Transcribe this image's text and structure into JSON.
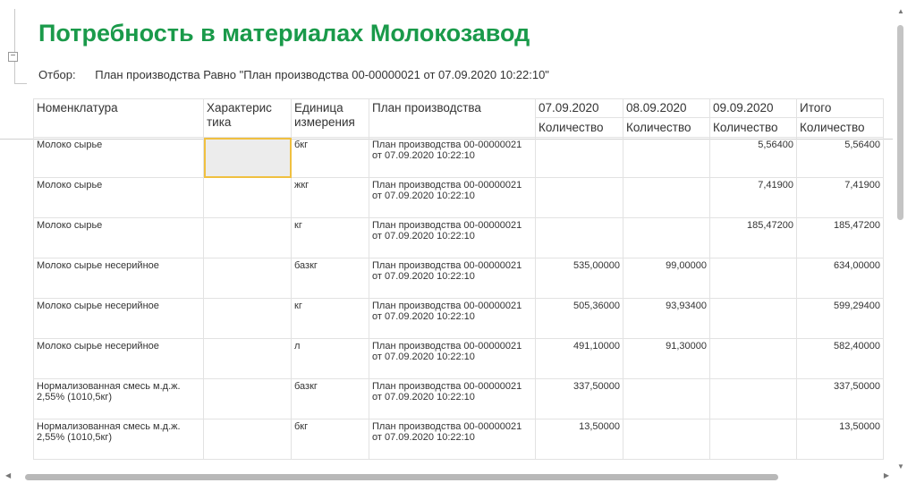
{
  "report": {
    "title": "Потребность в материалах Молокозавод",
    "filter_label": "Отбор:",
    "filter_value": "План производства Равно \"План производства 00-00000021 от 07.09.2020 10:22:10\""
  },
  "columns": {
    "nomenclature": "Номенклатура",
    "characteristic": "Характеристика",
    "unit": "Единица измерения",
    "plan": "План производства",
    "dates": [
      "07.09.2020",
      "08.09.2020",
      "09.09.2020"
    ],
    "total": "Итого",
    "quantity": "Количество"
  },
  "rows": [
    {
      "name": "Молоко сырье",
      "char": "",
      "unit": "бкг",
      "plan": "План производства 00-00000021 от 07.09.2020 10:22:10",
      "d1": "",
      "d2": "",
      "d3": "5,56400",
      "total": "5,56400"
    },
    {
      "name": "Молоко сырье",
      "char": "",
      "unit": "жкг",
      "plan": "План производства 00-00000021 от 07.09.2020 10:22:10",
      "d1": "",
      "d2": "",
      "d3": "7,41900",
      "total": "7,41900"
    },
    {
      "name": "Молоко сырье",
      "char": "",
      "unit": "кг",
      "plan": "План производства 00-00000021 от 07.09.2020 10:22:10",
      "d1": "",
      "d2": "",
      "d3": "185,47200",
      "total": "185,47200"
    },
    {
      "name": "Молоко сырье несерийное",
      "char": "",
      "unit": "базкг",
      "plan": "План производства 00-00000021 от 07.09.2020 10:22:10",
      "d1": "535,00000",
      "d2": "99,00000",
      "d3": "",
      "total": "634,00000"
    },
    {
      "name": "Молоко сырье несерийное",
      "char": "",
      "unit": "кг",
      "plan": "План производства 00-00000021 от 07.09.2020 10:22:10",
      "d1": "505,36000",
      "d2": "93,93400",
      "d3": "",
      "total": "599,29400"
    },
    {
      "name": "Молоко сырье несерийное",
      "char": "",
      "unit": "л",
      "plan": "План производства 00-00000021 от 07.09.2020 10:22:10",
      "d1": "491,10000",
      "d2": "91,30000",
      "d3": "",
      "total": "582,40000"
    },
    {
      "name": "Нормализованная смесь м.д.ж. 2,55% (1010,5кг)",
      "char": "",
      "unit": "базкг",
      "plan": "План производства 00-00000021 от 07.09.2020 10:22:10",
      "d1": "337,50000",
      "d2": "",
      "d3": "",
      "total": "337,50000"
    },
    {
      "name": "Нормализованная смесь м.д.ж. 2,55% (1010,5кг)",
      "char": "",
      "unit": "бкг",
      "plan": "План производства 00-00000021 от 07.09.2020 10:22:10",
      "d1": "13,50000",
      "d2": "",
      "d3": "",
      "total": "13,50000"
    }
  ],
  "icons": {
    "collapse": "minus-box-icon",
    "scroll_up": "arrow-up-icon",
    "scroll_down": "arrow-down-icon",
    "scroll_left": "arrow-left-icon",
    "scroll_right": "arrow-right-icon"
  },
  "colors": {
    "title": "#1a9a4a",
    "selection_border": "#f0c040"
  }
}
